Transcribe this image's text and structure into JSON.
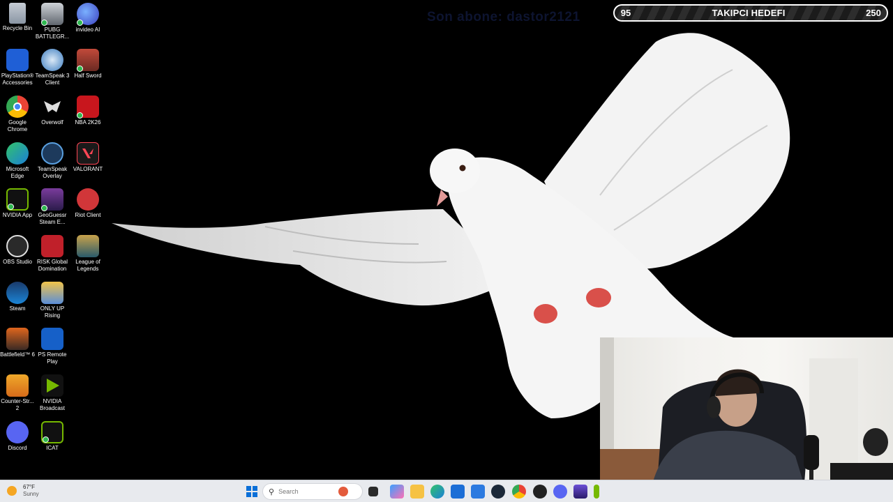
{
  "desktop": {
    "columns": [
      [
        {
          "label": "Recycle Bin",
          "icon": "recycle-bin-icon"
        },
        {
          "label": "PlayStation® Accessories",
          "icon": "playstation-icon"
        },
        {
          "label": "Google Chrome",
          "icon": "chrome-icon"
        },
        {
          "label": "Microsoft Edge",
          "icon": "edge-icon"
        },
        {
          "label": "NVIDIA App",
          "icon": "nvidia-icon"
        },
        {
          "label": "OBS Studio",
          "icon": "obs-icon"
        },
        {
          "label": "Steam",
          "icon": "steam-icon"
        },
        {
          "label": "Battlefield™ 6",
          "icon": "battlefield-icon"
        },
        {
          "label": "Counter-Str... 2",
          "icon": "counter-strike-icon"
        },
        {
          "label": "Discord",
          "icon": "discord-icon"
        }
      ],
      [
        {
          "label": "PUBG BATTLEGR...",
          "icon": "pubg-icon"
        },
        {
          "label": "TeamSpeak 3 Client",
          "icon": "teamspeak-icon"
        },
        {
          "label": "Overwolf",
          "icon": "overwolf-icon"
        },
        {
          "label": "TeamSpeak Overlay",
          "icon": "teamspeak-overlay-icon"
        },
        {
          "label": "GeoGuessr Steam E...",
          "icon": "geoguessr-icon"
        },
        {
          "label": "RISK Global Domination",
          "icon": "risk-icon"
        },
        {
          "label": "ONLY UP Rising",
          "icon": "only-up-icon"
        },
        {
          "label": "PS Remote Play",
          "icon": "ps-remote-play-icon"
        },
        {
          "label": "NVIDIA Broadcast",
          "icon": "nvidia-broadcast-icon"
        },
        {
          "label": "ICAT",
          "icon": "icat-icon"
        }
      ],
      [
        {
          "label": "invideo AI",
          "icon": "invideo-icon"
        },
        {
          "label": "Half Sword",
          "icon": "half-sword-icon"
        },
        {
          "label": "NBA 2K26",
          "icon": "nba-2k26-icon"
        },
        {
          "label": "VALORANT",
          "icon": "valorant-icon"
        },
        {
          "label": "Riot Client",
          "icon": "riot-client-icon"
        },
        {
          "label": "League of Legends",
          "icon": "league-of-legends-icon"
        }
      ]
    ]
  },
  "overlay": {
    "goal": {
      "current": "95",
      "title": "TAKIPCI HEDEFI",
      "target": "250"
    },
    "sub_text": "Son abone: dastor2121"
  },
  "taskbar": {
    "weather": {
      "temp": "67°F",
      "condition": "Sunny"
    },
    "search_placeholder": "Search"
  }
}
